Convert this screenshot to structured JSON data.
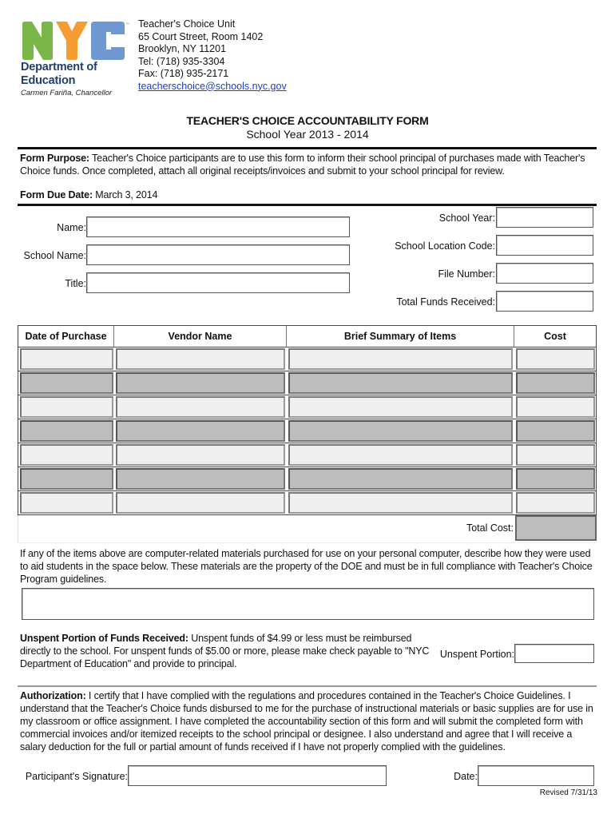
{
  "logo": {
    "letters": [
      "N",
      "Y",
      "C"
    ],
    "colors": {
      "n": "#7ab648",
      "y": "#f59d33",
      "c": "#6f98d3",
      "dept": "#1f3f6e"
    },
    "dept_line1": "Department of",
    "dept_line2": "Education",
    "chancellor": "Carmen Fariña, Chancellor",
    "trademark": "™"
  },
  "contact": {
    "unit": "Teacher's Choice Unit",
    "address1": "65 Court Street, Room 1402",
    "address2": "Brooklyn, NY 11201",
    "tel": "Tel: (718) 935-3304",
    "fax": "Fax: (718) 935-2171",
    "email": "teacherschoice@schools.nyc.gov"
  },
  "form": {
    "title": "TEACHER'S CHOICE ACCOUNTABILITY FORM",
    "subtitle": "School Year 2013 - 2014",
    "purpose_label": "Form Purpose:",
    "purpose_text": " Teacher's Choice participants are to use this form to inform their school principal of purchases made with Teacher's Choice funds. Once completed, attach all original receipts/invoices and submit to your school principal for review.",
    "due_label": "Form Due Date:",
    "due_text": " March 3, 2014"
  },
  "fields_left": [
    {
      "label": "Name:",
      "value": ""
    },
    {
      "label": "School Name:",
      "value": ""
    },
    {
      "label": "Title:",
      "value": ""
    }
  ],
  "fields_right": [
    {
      "label": "School Year:",
      "value": ""
    },
    {
      "label": "School Location Code:",
      "value": ""
    },
    {
      "label": "File Number:",
      "value": ""
    },
    {
      "label": "Total Funds Received:",
      "value": ""
    }
  ],
  "table": {
    "headers": [
      "Date of Purchase",
      "Vendor Name",
      "Brief Summary of Items",
      "Cost"
    ],
    "rows": [
      [
        "",
        "",
        "",
        ""
      ],
      [
        "",
        "",
        "",
        ""
      ],
      [
        "",
        "",
        "",
        ""
      ],
      [
        "",
        "",
        "",
        ""
      ],
      [
        "",
        "",
        "",
        ""
      ],
      [
        "",
        "",
        "",
        ""
      ],
      [
        "",
        "",
        "",
        ""
      ]
    ],
    "total_label": "Total Cost:",
    "total_value": ""
  },
  "computer": {
    "text": "If any of the items above are computer-related materials purchased for use on your personal computer, describe how they were used to aid students in the space below. These materials are the property of the DOE and must be in full compliance with Teacher's Choice Program guidelines.",
    "value": ""
  },
  "unspent": {
    "label": "Unspent Portion of Funds Received:",
    "text": " Unspent funds of $4.99 or less must be reimbursed directly to the school. For unspent funds of $5.00 or more, please make check payable to \"NYC Department of Education\" and provide to principal.",
    "field_label": "Unspent Portion:",
    "value": ""
  },
  "authorization": {
    "label": "Authorization:",
    "text": " I certify that I have complied with the regulations and procedures contained in the Teacher's Choice Guidelines. I understand that the Teacher's Choice funds disbursed to me for the purchase of instructional materials or basic supplies are for use in my classroom or office assignment. I have completed the accountability section of this form and will submit the completed form with commercial invoices and/or itemized receipts to the school principal or designee. I also understand and agree that I will receive a salary deduction for the full or partial amount of funds received if I have not properly complied with the guidelines."
  },
  "signature": {
    "label": "Participant's Signature:",
    "value": "",
    "date_label": "Date:",
    "date_value": ""
  },
  "footer": {
    "revised": "Revised 7/31/13"
  }
}
